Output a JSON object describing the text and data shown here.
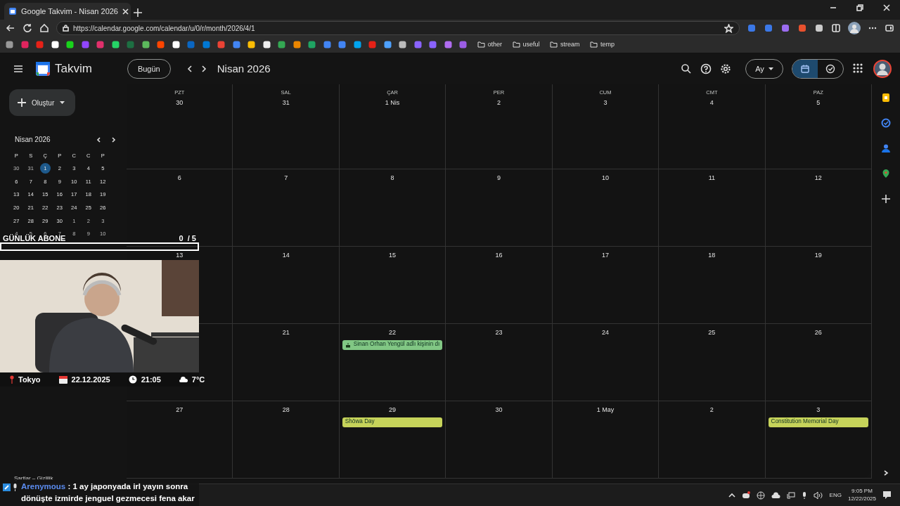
{
  "browser": {
    "tab_title": "Google Takvim - Nisan 2026",
    "url": "https://calendar.google.com/calendar/u/0/r/month/2026/4/1",
    "bookmark_folders": [
      "other",
      "useful",
      "stream",
      "temp"
    ]
  },
  "header": {
    "app_name": "Takvim",
    "today_button": "Bugün",
    "period": "Nisan 2026",
    "view": "Ay",
    "view_toggle": [
      {
        "kind": "calendar",
        "selected": true
      },
      {
        "kind": "tasks",
        "selected": false
      }
    ]
  },
  "sidebar": {
    "create_button": "Oluştur",
    "mini_calendar": {
      "title": "Nisan 2026",
      "weekdays": [
        "P",
        "S",
        "Ç",
        "P",
        "C",
        "C",
        "P"
      ],
      "weeks": [
        [
          {
            "d": "30",
            "outside": true,
            "selected": false
          },
          {
            "d": "31",
            "outside": true,
            "selected": false
          },
          {
            "d": "1",
            "outside": false,
            "selected": true
          },
          {
            "d": "2",
            "outside": false,
            "selected": false
          },
          {
            "d": "3",
            "outside": false,
            "selected": false
          },
          {
            "d": "4",
            "outside": false,
            "selected": false
          },
          {
            "d": "5",
            "outside": false,
            "selected": false
          }
        ],
        [
          {
            "d": "6",
            "outside": false,
            "selected": false
          },
          {
            "d": "7",
            "outside": false,
            "selected": false
          },
          {
            "d": "8",
            "outside": false,
            "selected": false
          },
          {
            "d": "9",
            "outside": false,
            "selected": false
          },
          {
            "d": "10",
            "outside": false,
            "selected": false
          },
          {
            "d": "11",
            "outside": false,
            "selected": false
          },
          {
            "d": "12",
            "outside": false,
            "selected": false
          }
        ],
        [
          {
            "d": "13",
            "outside": false,
            "selected": false
          },
          {
            "d": "14",
            "outside": false,
            "selected": false
          },
          {
            "d": "15",
            "outside": false,
            "selected": false
          },
          {
            "d": "16",
            "outside": false,
            "selected": false
          },
          {
            "d": "17",
            "outside": false,
            "selected": false
          },
          {
            "d": "18",
            "outside": false,
            "selected": false
          },
          {
            "d": "19",
            "outside": false,
            "selected": false
          }
        ],
        [
          {
            "d": "20",
            "outside": false,
            "selected": false
          },
          {
            "d": "21",
            "outside": false,
            "selected": false
          },
          {
            "d": "22",
            "outside": false,
            "selected": false
          },
          {
            "d": "23",
            "outside": false,
            "selected": false
          },
          {
            "d": "24",
            "outside": false,
            "selected": false
          },
          {
            "d": "25",
            "outside": false,
            "selected": false
          },
          {
            "d": "26",
            "outside": false,
            "selected": false
          }
        ],
        [
          {
            "d": "27",
            "outside": false,
            "selected": false
          },
          {
            "d": "28",
            "outside": false,
            "selected": false
          },
          {
            "d": "29",
            "outside": false,
            "selected": false
          },
          {
            "d": "30",
            "outside": false,
            "selected": false
          },
          {
            "d": "1",
            "outside": true,
            "selected": false
          },
          {
            "d": "2",
            "outside": true,
            "selected": false
          },
          {
            "d": "3",
            "outside": true,
            "selected": false
          }
        ],
        [
          {
            "d": "4",
            "outside": true,
            "selected": false
          },
          {
            "d": "5",
            "outside": true,
            "selected": false
          },
          {
            "d": "6",
            "outside": true,
            "selected": false
          },
          {
            "d": "7",
            "outside": true,
            "selected": false
          },
          {
            "d": "8",
            "outside": true,
            "selected": false
          },
          {
            "d": "9",
            "outside": true,
            "selected": false
          },
          {
            "d": "10",
            "outside": true,
            "selected": false
          }
        ]
      ]
    },
    "footer": "Şartlar – Gizlilik"
  },
  "month": {
    "weekdays": [
      "PZT",
      "SAL",
      "ÇAR",
      "PER",
      "CUM",
      "CMT",
      "PAZ"
    ],
    "weeks": [
      [
        {
          "day": "30"
        },
        {
          "day": "31"
        },
        {
          "day": "1 Nis"
        },
        {
          "day": "2"
        },
        {
          "day": "3"
        },
        {
          "day": "4"
        },
        {
          "day": "5"
        }
      ],
      [
        {
          "day": "6"
        },
        {
          "day": "7"
        },
        {
          "day": "8"
        },
        {
          "day": "9"
        },
        {
          "day": "10"
        },
        {
          "day": "11"
        },
        {
          "day": "12"
        }
      ],
      [
        {
          "day": "13"
        },
        {
          "day": "14"
        },
        {
          "day": "15"
        },
        {
          "day": "16"
        },
        {
          "day": "17"
        },
        {
          "day": "18"
        },
        {
          "day": "19"
        }
      ],
      [
        {
          "day": "21"
        },
        {
          "day": "22",
          "events": [
            {
              "title": "Sinan Orhan Yengül adlı kişinin dı",
              "kind": "birthday",
              "color": "#81c784"
            }
          ]
        },
        {
          "day": "23"
        },
        {
          "day": "24"
        },
        {
          "day": "25"
        },
        {
          "day": "26"
        }
      ],
      [
        {
          "day": "27"
        },
        {
          "day": "28"
        },
        {
          "day": "29",
          "events": [
            {
              "title": "Shōwa Day",
              "kind": "holiday",
              "color": "#c6d35a"
            }
          ]
        },
        {
          "day": "30"
        },
        {
          "day": "1 May"
        },
        {
          "day": "2"
        },
        {
          "day": "3",
          "events": [
            {
              "title": "Constitution Memorial Day",
              "kind": "holiday",
              "color": "#c6d35a"
            }
          ]
        }
      ]
    ]
  },
  "overlay": {
    "subscriber_goal": {
      "label": "GÜNLÜK ABONE",
      "count": "0  / 5",
      "level": 0
    },
    "info": {
      "city": "Tokyo",
      "date": "22.12.2025",
      "time": "21:05",
      "weather": "7°C"
    },
    "chat": {
      "user": "Arenymous",
      "message": ": 1 ay japonyada irl yayın sonra dönüşte izmirde jenguel gezmecesi fena akar"
    }
  },
  "taskbar": {
    "language": "ENG",
    "time": "9:05 PM",
    "date": "12/22/2025"
  }
}
